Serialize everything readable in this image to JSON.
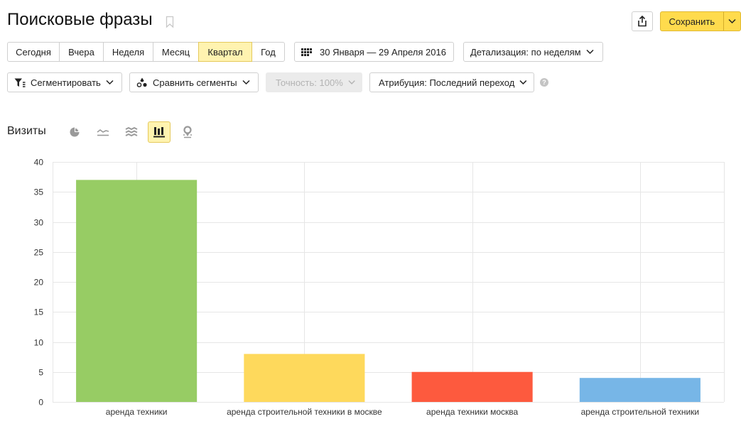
{
  "page": {
    "title": "Поисковые фразы"
  },
  "toolbar": {
    "save_label": "Сохранить"
  },
  "periods": [
    {
      "label": "Сегодня",
      "active": false
    },
    {
      "label": "Вчера",
      "active": false
    },
    {
      "label": "Неделя",
      "active": false
    },
    {
      "label": "Месяц",
      "active": false
    },
    {
      "label": "Квартал",
      "active": true
    },
    {
      "label": "Год",
      "active": false
    }
  ],
  "date_range": {
    "label": "30 Января — 29 Апреля 2016"
  },
  "detail": {
    "label": "Детализация: по неделям"
  },
  "filters": {
    "segment_label": "Сегментировать",
    "compare_label": "Сравнить сегменты",
    "accuracy_label": "Точность: 100%",
    "attribution_label": "Атрибуция: Последний переход",
    "help_text": "?"
  },
  "metric": {
    "label": "Визиты"
  },
  "view_icons": [
    "pie-chart-icon",
    "line-chart-icon",
    "area-chart-icon",
    "bar-chart-icon",
    "map-icon"
  ],
  "chart_data": {
    "type": "bar",
    "categories": [
      "аренда техники",
      "аренда строительной техники в москве",
      "аренда техники москва",
      "аренда строительной техники"
    ],
    "values": [
      37,
      8,
      5,
      4
    ],
    "colors": [
      "#97cc64",
      "#fed95c",
      "#fd5a3e",
      "#77b6e7"
    ],
    "ylim": [
      0,
      40
    ],
    "yticks": [
      0,
      5,
      10,
      15,
      20,
      25,
      30,
      35,
      40
    ],
    "grid": true,
    "title": "",
    "xlabel": "",
    "ylabel": ""
  }
}
